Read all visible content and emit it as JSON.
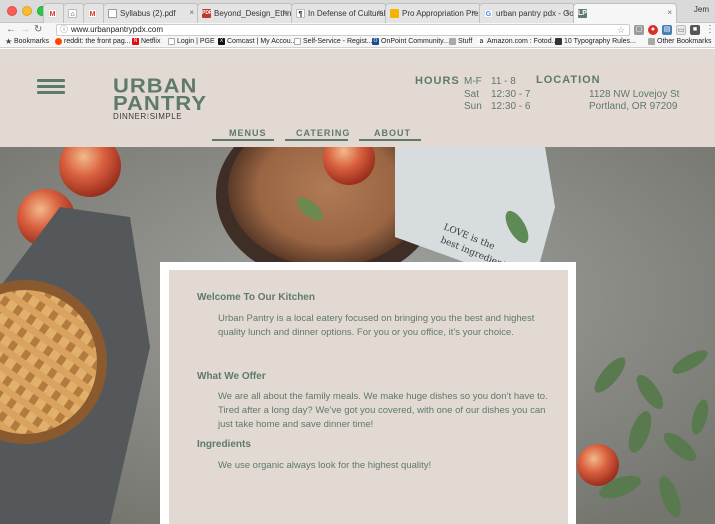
{
  "browser": {
    "tabs": [
      {
        "label": "",
        "icon": "gmail"
      },
      {
        "label": "",
        "icon": "home"
      },
      {
        "label": "",
        "icon": "gmail"
      },
      {
        "label": "Syllabus (2).pdf",
        "icon": "document"
      },
      {
        "label": "Beyond_Design_Ethnog",
        "icon": "pdf"
      },
      {
        "label": "In Defense of Cultural A",
        "icon": "web"
      },
      {
        "label": "Pro Appropriation Press",
        "icon": "slides"
      },
      {
        "label": "urban pantry pdx - Goog",
        "icon": "google"
      },
      {
        "label": "",
        "icon": "urban-pantry"
      }
    ],
    "profile_name": "Jem",
    "url": "www.urbanpantrypdx.com",
    "bookmarks": [
      {
        "label": "Bookmarks"
      },
      {
        "label": "reddit: the front pag..."
      },
      {
        "label": "Netflix"
      },
      {
        "label": "Login | PGE"
      },
      {
        "label": "Comcast | My Accou..."
      },
      {
        "label": "Self-Service - Regist..."
      },
      {
        "label": "OnPoint Community..."
      },
      {
        "label": "Stuff"
      },
      {
        "label": "Amazon.com : Fotod..."
      },
      {
        "label": "10 Typography Rules..."
      },
      {
        "label": "Other Bookmarks"
      }
    ]
  },
  "site": {
    "logo": {
      "line1": "URBAN",
      "line2": "PANTRY",
      "tagline": "DINNER⁝SIMPLE"
    },
    "hours": {
      "title": "HOURS",
      "rows": [
        {
          "days": "M-F",
          "time": "11 - 8"
        },
        {
          "days": "Sat",
          "time": "12:30 - 7"
        },
        {
          "days": "Sun",
          "time": "12:30 - 6"
        }
      ]
    },
    "location": {
      "title": "LOCATION",
      "line1": "1128 NW Lovejoy St",
      "line2": "Portland, OR 97209"
    },
    "nav": [
      "MENUS",
      "CATERING",
      "ABOUT"
    ],
    "hero_napkin_text": [
      "LOVE is the",
      "best ingredient"
    ],
    "sections": [
      {
        "title": "Welcome To Our Kitchen",
        "body": "Urban Pantry is a local eatery focused on bringing you the best and highest quality lunch and dinner options. For you or you office, it’s your choice."
      },
      {
        "title": "What We Offer",
        "body": "We are all about the family meals. We make huge dishes so you don’t have to. Tired after a long day? We’ve got you covered, with one of our dishes you can just take home and save dinner time!"
      },
      {
        "title": "Ingredients",
        "body": "We use organic always look for the highest quality!"
      }
    ],
    "colors": {
      "brand_green": "#5e7a6a",
      "header_bg": "#e2d9d2",
      "card_bg": "#e2d9d2"
    }
  }
}
